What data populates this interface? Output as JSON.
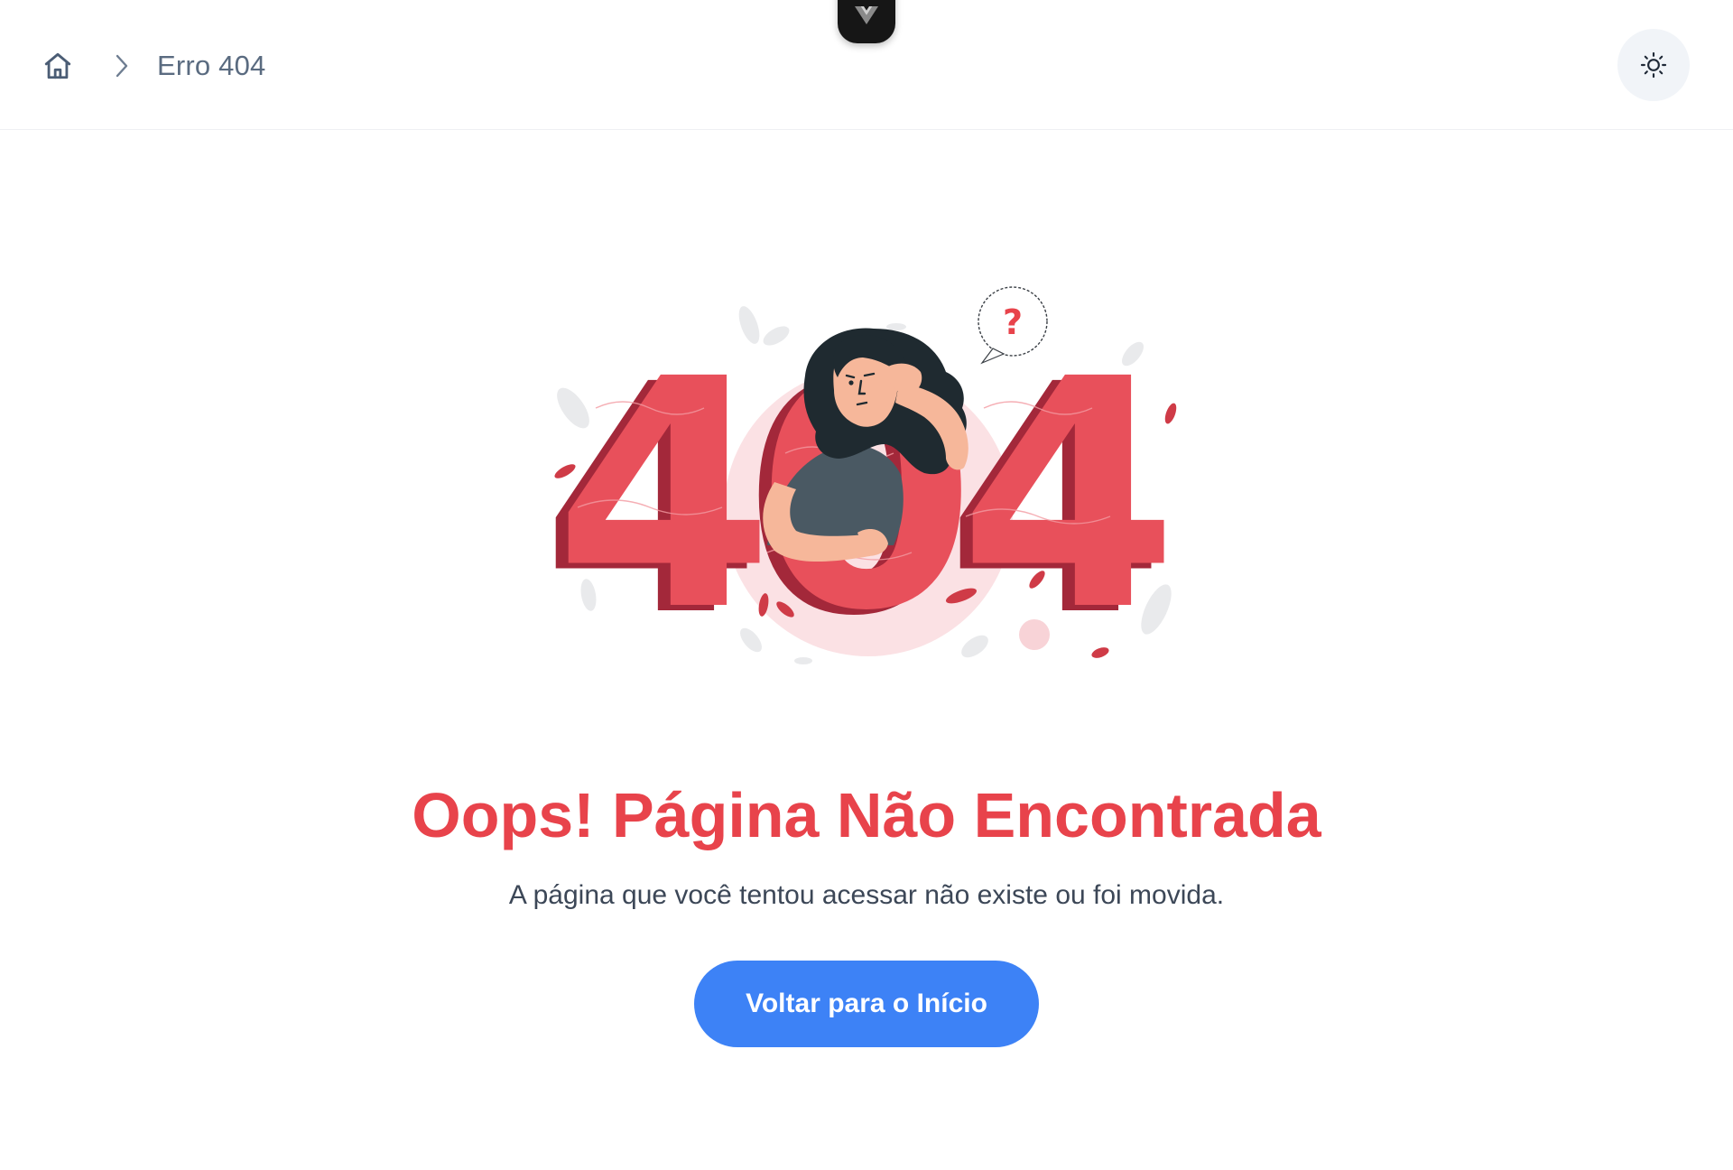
{
  "header": {
    "breadcrumb": {
      "home_icon": "home-icon",
      "separator_icon": "chevron-right-icon",
      "current": "Erro 404"
    },
    "badge_letter": "V",
    "theme_toggle_icon": "sun-icon"
  },
  "illustration": {
    "number": "404",
    "question_mark": "?",
    "colors": {
      "primary": "#e8505b",
      "shadow": "#a3283a",
      "hair": "#1f2a30",
      "shirt": "#4a5963",
      "skin": "#f6b79a",
      "halo": "#fbe1e4"
    }
  },
  "main": {
    "title": "Oops! Página Não Encontrada",
    "subtitle": "A página que você tentou acessar não existe ou foi movida.",
    "cta_label": "Voltar para o Início"
  },
  "colors": {
    "title": "#e8434b",
    "cta": "#3d82f6",
    "text": "#3c4757",
    "breadcrumb": "#5a6b80"
  }
}
